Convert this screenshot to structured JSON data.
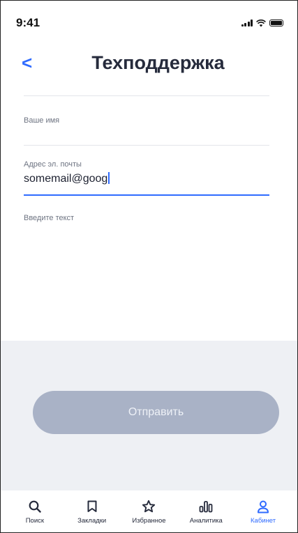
{
  "status_bar": {
    "time": "9:41"
  },
  "header": {
    "back_label": "<",
    "title": "Техподдержка"
  },
  "form": {
    "name": {
      "label": "Ваше имя",
      "value": ""
    },
    "email": {
      "label": "Адрес эл. почты",
      "value": "somemail@goog"
    },
    "message": {
      "placeholder": "Введите текст",
      "value": ""
    },
    "submit_label": "Отправить"
  },
  "tabbar": {
    "items": [
      {
        "label": "Поиск",
        "icon": "search-icon"
      },
      {
        "label": "Закладки",
        "icon": "bookmark-icon"
      },
      {
        "label": "Избранное",
        "icon": "star-icon"
      },
      {
        "label": "Аналитика",
        "icon": "analytics-icon"
      },
      {
        "label": "Кабинет",
        "icon": "person-icon"
      }
    ],
    "active_index": 4
  },
  "colors": {
    "accent": "#2f6bff",
    "title": "#262b3c",
    "button_disabled": "#a9b2c6",
    "gray_area": "#eef0f4"
  }
}
